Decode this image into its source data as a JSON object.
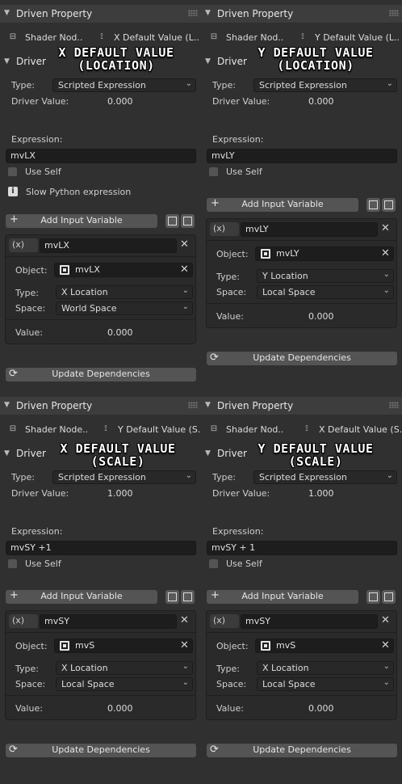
{
  "panels": {
    "tl": {
      "header_title": "Driven Property",
      "driven_tab_1": "Shader Nod..",
      "driven_tab_2": "X Default Value (L..",
      "section_title": "Driver",
      "annotation_line1": "X DEFAULT VALUE",
      "annotation_line2": "(LOCATION)",
      "type_label": "Type:",
      "type_value": "Scripted Expression",
      "driver_value_label": "Driver Value:",
      "driver_value": "0.000",
      "expression_label": "Expression:",
      "expression_value": "mvLX",
      "use_self_label": "Use Self",
      "warning": "Slow Python expression",
      "add_input_variable": "Add Input Variable",
      "var_name": "mvLX",
      "object_label": "Object:",
      "object_value": "mvLX",
      "var_type_label": "Type:",
      "var_type_value": "X Location",
      "space_label": "Space:",
      "space_value": "World Space",
      "value_label": "Value:",
      "value": "0.000",
      "update_dependencies": "Update Dependencies"
    },
    "tr": {
      "header_title": "Driven Property",
      "driven_tab_1": "Shader Nod..",
      "driven_tab_2": "Y Default Value (L..",
      "section_title": "Driver",
      "annotation_line1": "Y DEFAULT VALUE",
      "annotation_line2": "(LOCATION)",
      "type_label": "Type:",
      "type_value": "Scripted Expression",
      "driver_value_label": "Driver Value:",
      "driver_value": "0.000",
      "expression_label": "Expression:",
      "expression_value": "mvLY",
      "use_self_label": "Use Self",
      "add_input_variable": "Add Input Variable",
      "var_name": "mvLY",
      "object_label": "Object:",
      "object_value": "mvLY",
      "var_type_label": "Type:",
      "var_type_value": "Y Location",
      "space_label": "Space:",
      "space_value": "Local Space",
      "value_label": "Value:",
      "value": "0.000",
      "update_dependencies": "Update Dependencies"
    },
    "bl": {
      "header_title": "Driven Property",
      "driven_tab_1": "Shader Node..",
      "driven_tab_2": "Y Default Value (S..",
      "section_title": "Driver",
      "annotation_line1": "X DEFAULT VALUE",
      "annotation_line2": "(SCALE)",
      "type_label": "Type:",
      "type_value": "Scripted Expression",
      "driver_value_label": "Driver Value:",
      "driver_value": "1.000",
      "expression_label": "Expression:",
      "expression_value": "mvSY +1",
      "use_self_label": "Use Self",
      "add_input_variable": "Add Input Variable",
      "var_name": "mvSY",
      "object_label": "Object:",
      "object_value": "mvS",
      "var_type_label": "Type:",
      "var_type_value": "X Location",
      "space_label": "Space:",
      "space_value": "Local Space",
      "value_label": "Value:",
      "value": "0.000",
      "update_dependencies": "Update Dependencies"
    },
    "br": {
      "header_title": "Driven Property",
      "driven_tab_1": "Shader Nod..",
      "driven_tab_2": "X Default Value (S..",
      "section_title": "Driver",
      "annotation_line1": "Y DEFAULT VALUE",
      "annotation_line2": "(SCALE)",
      "type_label": "Type:",
      "type_value": "Scripted Expression",
      "driver_value_label": "Driver Value:",
      "driver_value": "1.000",
      "expression_label": "Expression:",
      "expression_value": "mvSY + 1",
      "use_self_label": "Use Self",
      "add_input_variable": "Add Input Variable",
      "var_name": "mvSY",
      "object_label": "Object:",
      "object_value": "mvS",
      "var_type_label": "Type:",
      "var_type_value": "X Location",
      "space_label": "Space:",
      "space_value": "Local Space",
      "value_label": "Value:",
      "value": "0.000",
      "update_dependencies": "Update Dependencies"
    }
  },
  "icons": {
    "variable_type_glyph": "(x)",
    "close_glyph": "✕",
    "chevron_glyph": "⌄"
  }
}
